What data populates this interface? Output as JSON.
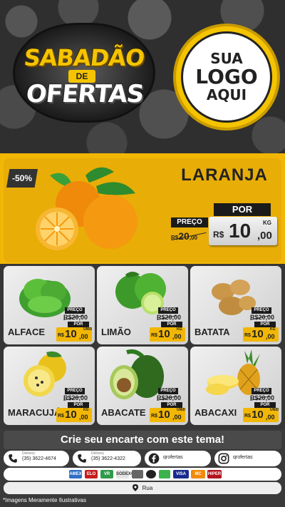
{
  "header": {
    "title_line1": "SABADÃO",
    "title_de": "DE",
    "title_line2": "OFERTAS",
    "logo_line1": "SUA",
    "logo_line2": "LOGO",
    "logo_line3": "AQUI"
  },
  "hero": {
    "discount": "-50%",
    "product": "LARANJA",
    "preco_label": "PREÇO",
    "old_currency": "R$",
    "old_int": "20",
    "old_cents": ",00",
    "por_label": "POR",
    "currency": "R$",
    "price_int": "10",
    "price_cents": ",00",
    "unit": "KG"
  },
  "products": [
    {
      "name": "ALFACE",
      "preco": "PREÇO",
      "old": "R$20,00",
      "por": "POR",
      "currency": "R$",
      "int": "10",
      "cents": ",00",
      "unit": "UNID"
    },
    {
      "name": "LIMÃO",
      "preco": "PREÇO",
      "old": "R$20,00",
      "por": "POR",
      "currency": "R$",
      "int": "10",
      "cents": ",00",
      "unit": "KG"
    },
    {
      "name": "BATATA",
      "preco": "PREÇO",
      "old": "R$20,00",
      "por": "POR",
      "currency": "R$",
      "int": "10",
      "cents": ",00",
      "unit": "KG"
    },
    {
      "name": "MARACUJÁ",
      "preco": "PREÇO",
      "old": "R$20,00",
      "por": "POR",
      "currency": "R$",
      "int": "10",
      "cents": ",00",
      "unit": "KG"
    },
    {
      "name": "ABACATE",
      "preco": "PREÇO",
      "old": "R$20,00",
      "por": "POR",
      "currency": "R$",
      "int": "10",
      "cents": ",00",
      "unit": "UNID"
    },
    {
      "name": "ABACAXI",
      "preco": "PREÇO",
      "old": "R$20,00",
      "por": "POR",
      "currency": "R$",
      "int": "10",
      "cents": ",00",
      "unit": "UNID"
    }
  ],
  "cta": "Crie seu encarte com este tema!",
  "contacts": [
    {
      "icon": "phone-icon",
      "label": "Delivery",
      "value": "(35) 3622-4674"
    },
    {
      "icon": "phone-icon",
      "label": "Delivery",
      "value": "(35) 3622-4322"
    },
    {
      "icon": "facebook-icon",
      "label": "",
      "value": "qrofertas"
    },
    {
      "icon": "instagram-icon",
      "label": "",
      "value": "qrofertas"
    }
  ],
  "payments": [
    "AMEX",
    "ELO",
    "VR",
    "SODEXO",
    "",
    "",
    "",
    "VISA",
    "MC",
    "HIPER"
  ],
  "address": "Rua",
  "disclaimer": "*Imagens Meramente Ilustrativas",
  "colors": {
    "accent": "#f2b705",
    "dark": "#363636"
  }
}
